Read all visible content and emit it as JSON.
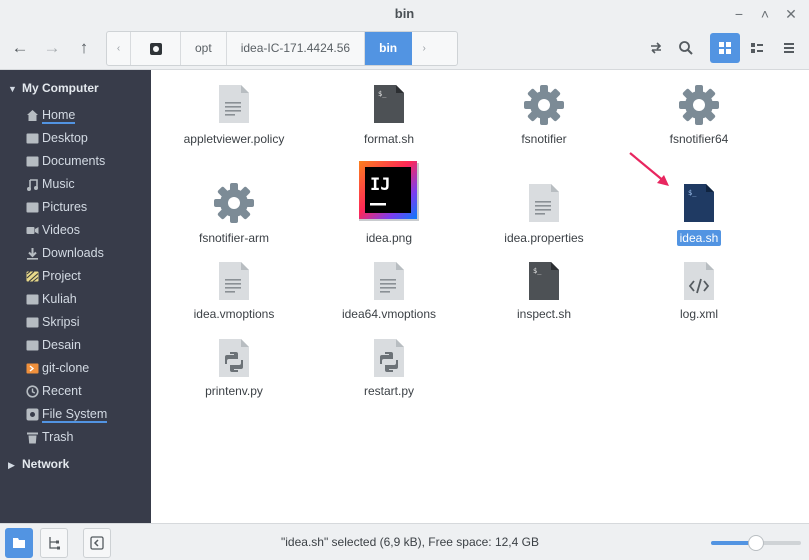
{
  "window": {
    "title": "bin"
  },
  "path": [
    "opt",
    "idea-IC-171.4424.56",
    "bin"
  ],
  "sidebar": {
    "sections": [
      {
        "label": "My Computer",
        "expanded": true
      },
      {
        "label": "Network",
        "expanded": false
      }
    ],
    "items": [
      {
        "label": "Home",
        "icon": "home-icon"
      },
      {
        "label": "Desktop",
        "icon": "folder-icon"
      },
      {
        "label": "Documents",
        "icon": "folder-icon"
      },
      {
        "label": "Music",
        "icon": "music-icon"
      },
      {
        "label": "Pictures",
        "icon": "folder-icon"
      },
      {
        "label": "Videos",
        "icon": "video-icon"
      },
      {
        "label": "Downloads",
        "icon": "download-icon"
      },
      {
        "label": "Project",
        "icon": "folder-icon"
      },
      {
        "label": "Kuliah",
        "icon": "folder-icon"
      },
      {
        "label": "Skripsi",
        "icon": "folder-icon"
      },
      {
        "label": "Desain",
        "icon": "folder-icon"
      },
      {
        "label": "git-clone",
        "icon": "folder-icon"
      },
      {
        "label": "Recent",
        "icon": "clock-icon"
      },
      {
        "label": "File System",
        "icon": "drive-icon"
      },
      {
        "label": "Trash",
        "icon": "trash-icon"
      }
    ]
  },
  "files": [
    {
      "name": "appletviewer.policy",
      "icon": "text-file-icon"
    },
    {
      "name": "format.sh",
      "icon": "script-file-icon"
    },
    {
      "name": "fsnotifier",
      "icon": "executable-gear-icon"
    },
    {
      "name": "fsnotifier64",
      "icon": "executable-gear-icon"
    },
    {
      "name": "fsnotifier-arm",
      "icon": "executable-gear-icon"
    },
    {
      "name": "idea.png",
      "icon": "intellij-image-icon",
      "image_text": "IJ"
    },
    {
      "name": "idea.properties",
      "icon": "text-file-icon"
    },
    {
      "name": "idea.sh",
      "icon": "script-file-icon",
      "selected": true
    },
    {
      "name": "idea.vmoptions",
      "icon": "text-file-icon"
    },
    {
      "name": "idea64.vmoptions",
      "icon": "text-file-icon"
    },
    {
      "name": "inspect.sh",
      "icon": "script-file-icon"
    },
    {
      "name": "log.xml",
      "icon": "xml-file-icon"
    },
    {
      "name": "printenv.py",
      "icon": "python-file-icon"
    },
    {
      "name": "restart.py",
      "icon": "python-file-icon"
    }
  ],
  "status": {
    "text": "\"idea.sh\" selected (6,9 kB), Free space: 12,4 GB",
    "zoom_fraction": 0.5
  },
  "colors": {
    "accent": "#5294e2",
    "sidebar_bg": "#383c4a",
    "annotation_arrow": "#e8265f"
  }
}
